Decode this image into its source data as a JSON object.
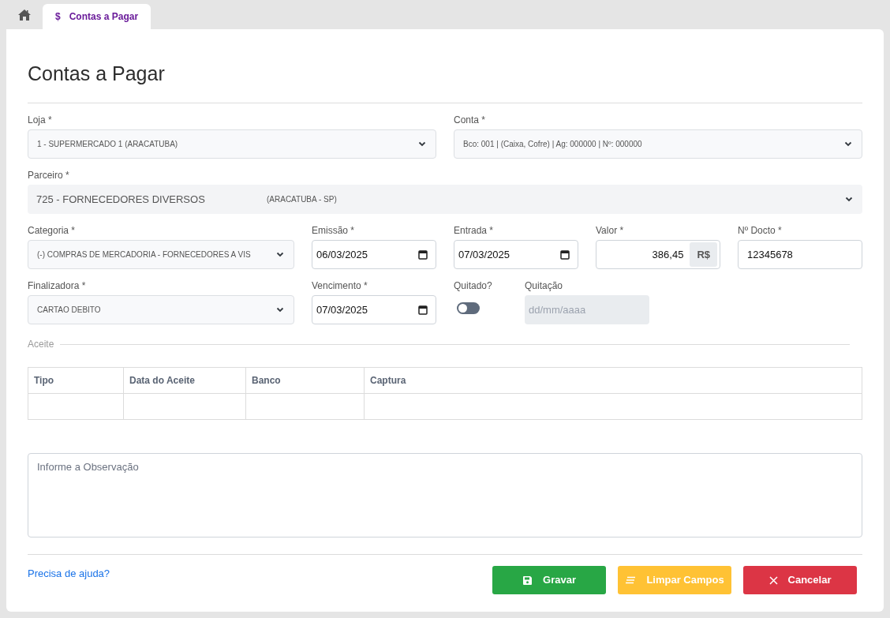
{
  "tabs": [
    {
      "icon_text": "$",
      "label": "Contas a Pagar",
      "selected": true
    }
  ],
  "page_title": "Contas a Pagar",
  "form_rows": [
    [
      {
        "kind": "select",
        "label": "Loja *",
        "value": "1 - SUPERMERCADO 1 (ARACATUBA)"
      },
      {
        "kind": "select",
        "label": "Conta *",
        "value": "Bco: 001 | (Caixa, Cofre) | Ag: 000000 | Nº: 000000"
      }
    ],
    [
      {
        "kind": "locked-select",
        "label": "Parceiro *",
        "parts": [
          "725 - FORNECEDORES DIVERSOS",
          "(ARACATUBA - SP)"
        ]
      }
    ],
    [
      {
        "kind": "select",
        "label": "Categoria *",
        "value": "(-) COMPRAS DE MERCADORIA - FORNECEDORES A VIS"
      },
      {
        "kind": "date",
        "label": "Emissão *",
        "value": "06/03/2025"
      },
      {
        "kind": "date",
        "label": "Entrada *",
        "value": "07/03/2025"
      },
      {
        "kind": "money",
        "label": "Valor *",
        "value": "386,45",
        "addon": "R$"
      },
      {
        "kind": "text",
        "label": "Nº Docto *",
        "value": "12345678"
      }
    ],
    [
      {
        "kind": "select",
        "label": "Finalizadora *",
        "value": "CARTAO DEBITO"
      },
      {
        "kind": "date",
        "label": "Vencimento *",
        "value": "07/03/2025"
      },
      {
        "kind": "toggle",
        "label": "Quitado?",
        "on": false
      },
      {
        "kind": "disabled-date",
        "label": "Quitação",
        "placeholder": "dd/mm/aaaa"
      }
    ]
  ],
  "aceite": {
    "legend": "Aceite",
    "columns": [
      "Tipo",
      "Data do Aceite",
      "Banco",
      "Captura"
    ]
  },
  "observation": {
    "placeholder": "Informe a Observação"
  },
  "help_link": "Precisa de ajuda?",
  "buttons": [
    {
      "kind": "save",
      "label": "Gravar"
    },
    {
      "kind": "clear",
      "label": "Limpar Campos"
    },
    {
      "kind": "cancel",
      "label": "Cancelar"
    }
  ]
}
